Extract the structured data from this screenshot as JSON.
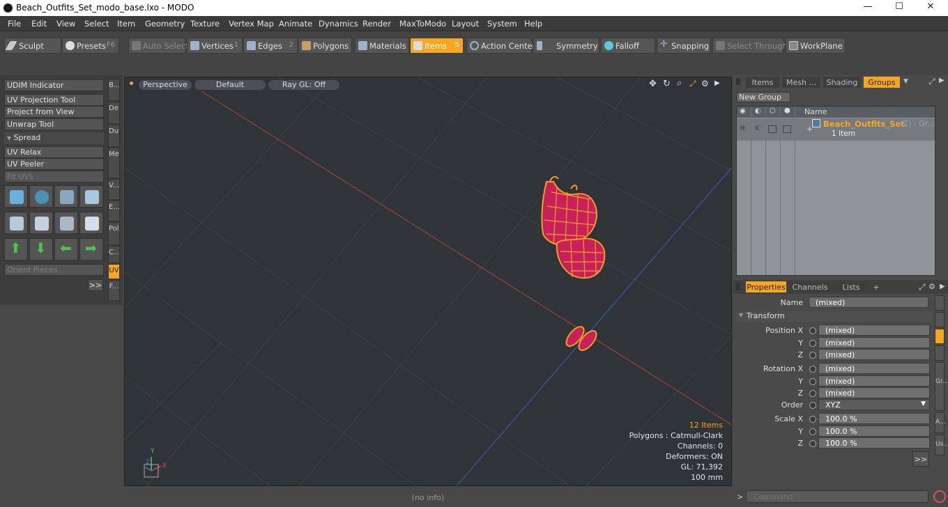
{
  "window": {
    "title": "Beach_Outfits_Set_modo_base.lxo - MODO",
    "minimize": "—",
    "maximize": "☐",
    "close": "✕"
  },
  "menu": [
    "File",
    "Edit",
    "View",
    "Select",
    "Item",
    "Geometry",
    "Texture",
    "Vertex Map",
    "Animate",
    "Dynamics",
    "Render",
    "MaxToModo",
    "Layout",
    "System",
    "Help"
  ],
  "toolbar": {
    "sculpt": "Sculpt",
    "presets": "Presets",
    "presets_key": "F6",
    "auto_select": "Auto Select",
    "vertices": "Vertices",
    "vertices_num": "1",
    "edges": "Edges",
    "edges_num": "2",
    "polygons": "Polygons",
    "materials": "Materials",
    "items": "Items",
    "items_num": "5",
    "action_center": "Action Center",
    "symmetry": "Symmetry",
    "falloff": "Falloff",
    "snapping": "Snapping",
    "select_through": "Select Through",
    "workplane": "WorkPlane"
  },
  "left": {
    "udim": "UDIM Indicator",
    "uv_projection": "UV Projection Tool",
    "project_view": "Project from View",
    "unwrap": "Unwrap Tool",
    "spread": "Spread",
    "uv_relax": "UV Relax",
    "uv_peeler": "UV Peeler",
    "fit_uvs": "Fit UVs",
    "orient": "Orient Pieces",
    "more": ">>",
    "vtabs": [
      "B...",
      "De...",
      "Du...",
      "Mes...",
      "V...",
      "E...",
      "Pol...",
      "C...",
      "UV",
      "F..."
    ]
  },
  "viewport": {
    "perspective": "Perspective",
    "default": "Default",
    "raygl": "Ray GL: Off",
    "info": {
      "items": "12 Items",
      "polygons": "Polygons : Catmull-Clark",
      "channels": "Channels: 0",
      "deformers": "Deformers: ON",
      "gl": "GL: 71,392",
      "unit": "100 mm"
    },
    "axis_y": "Y",
    "axis_x": "X",
    "axis_z": "Z"
  },
  "status": "(no info)",
  "right": {
    "tabs": [
      "Items",
      "Mesh ...",
      "Shading",
      "Groups"
    ],
    "new_group": "New Group",
    "name_col": "Name",
    "group_name": "Beach_Outfits_Set",
    "group_count": "(2) : Gr...",
    "group_sub": "1 Item",
    "prop_tabs": [
      "Properties",
      "Channels",
      "Lists",
      "+"
    ],
    "name_label": "Name",
    "name_value": "(mixed)",
    "transform": "Transform",
    "pos_x": "Position X",
    "rot_x": "Rotation X",
    "scale_x": "Scale X",
    "y": "Y",
    "z": "Z",
    "order": "Order",
    "order_value": "XYZ",
    "mixed": "(mixed)",
    "scale_val": "100.0 %",
    "side_tabs": [
      "Gr...",
      "A...",
      "Us..."
    ],
    "more": ">>",
    "command": "Command"
  },
  "colors": {
    "accent": "#f6a623",
    "viewport_bg": "#2f3438",
    "red_axis": "#b8443a",
    "blue_axis": "#4a58c0",
    "mesh": "#f0a020",
    "mesh_fill": "#c8205a"
  }
}
